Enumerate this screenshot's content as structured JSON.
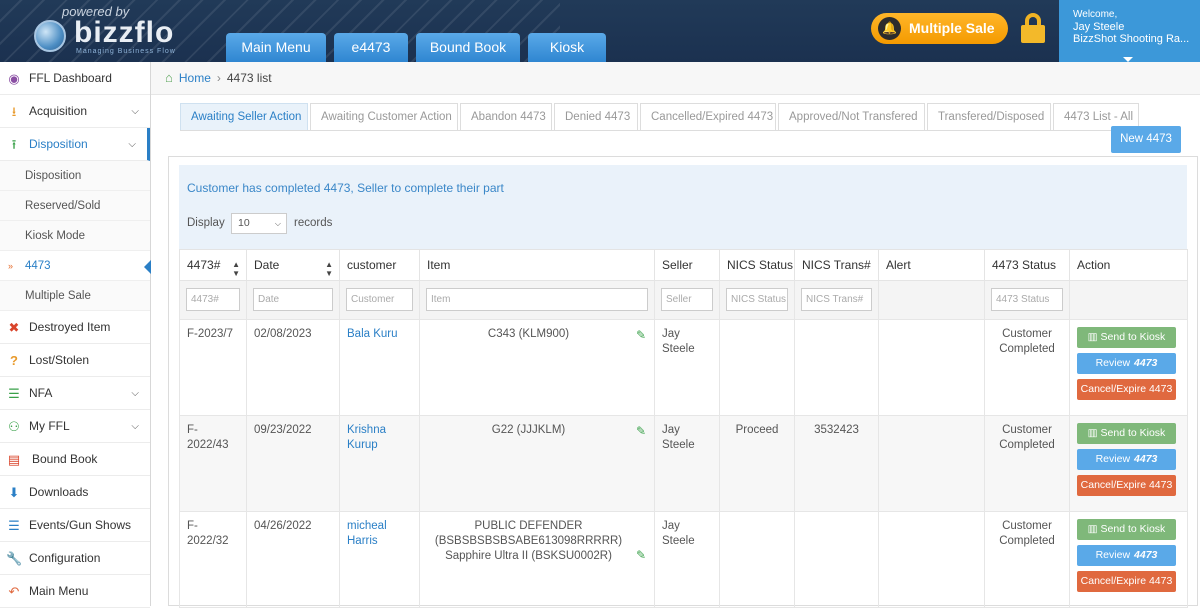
{
  "header": {
    "powered_by": "powered by",
    "brand": "bizzflo",
    "tagline": "Managing Business Flow",
    "nav_tabs": [
      "Main Menu",
      "e4473",
      "Bound Book",
      "Kiosk"
    ],
    "multiple_sale_label": "Multiple Sale",
    "user": {
      "welcome": "Welcome,",
      "name": "Jay Steele",
      "company": "BizzShot Shooting Ra..."
    },
    "colors": {
      "nav_tab": "#3f94da",
      "multiple_sale": "#f5a313",
      "user_box": "#3c98d9"
    }
  },
  "sidebar": {
    "items": [
      {
        "label": "FFL Dashboard",
        "icon": "palette-icon"
      },
      {
        "label": "Acquisition",
        "icon": "download-tray-icon"
      },
      {
        "label": "Disposition",
        "icon": "upload-tray-icon"
      },
      {
        "label": "Destroyed Item",
        "icon": "x-icon"
      },
      {
        "label": "Lost/Stolen",
        "icon": "question-icon"
      },
      {
        "label": "NFA",
        "icon": "list-icon"
      },
      {
        "label": "My FFL",
        "icon": "users-icon"
      },
      {
        "label": "Bound Book",
        "icon": "book-icon"
      },
      {
        "label": "Downloads",
        "icon": "download-circle-icon"
      },
      {
        "label": "Events/Gun Shows",
        "icon": "list-icon"
      },
      {
        "label": "Configuration",
        "icon": "wrench-icon"
      },
      {
        "label": "Main Menu",
        "icon": "back-arrow-icon"
      }
    ],
    "disposition_sub": [
      "Disposition",
      "Reserved/Sold",
      "Kiosk Mode",
      "4473",
      "Multiple Sale"
    ]
  },
  "breadcrumb": {
    "home": "Home",
    "current": "4473 list"
  },
  "tabs": [
    "Awaiting Seller Action",
    "Awaiting Customer Action",
    "Abandon 4473",
    "Denied 4473",
    "Cancelled/Expired 4473",
    "Approved/Not Transfered",
    "Transfered/Disposed",
    "4473 List - All"
  ],
  "new_button": "New 4473",
  "info": {
    "message": "Customer has completed 4473, Seller to complete their part",
    "display_label": "Display",
    "display_value": "10",
    "records_label": "records"
  },
  "table": {
    "headers": [
      "4473#",
      "Date",
      "customer",
      "Item",
      "Seller",
      "NICS Status",
      "NICS Trans#",
      "Alert",
      "4473 Status",
      "Action"
    ],
    "filters": [
      "4473#",
      "Date",
      "Customer",
      "Item",
      "Seller",
      "NICS Status",
      "NICS Trans#",
      "",
      "4473 Status",
      ""
    ],
    "actions": {
      "kiosk": "Send to Kiosk",
      "review": "Review",
      "review_em": "4473",
      "cancel": "Cancel/Expire 4473"
    },
    "rows": [
      {
        "num": "F-2023/7",
        "date": "02/08/2023",
        "customer": "Bala Kuru",
        "item": "C343 (KLM900)",
        "seller": "Jay Steele",
        "nics_status": "",
        "nics_trans": "",
        "alert": "",
        "status": "Customer Completed"
      },
      {
        "num": "F-2022/43",
        "date": "09/23/2022",
        "customer": "Krishna Kurup",
        "item": "G22 (JJJKLM)",
        "seller": "Jay Steele",
        "nics_status": "Proceed",
        "nics_trans": "3532423",
        "alert": "",
        "status": "Customer Completed"
      },
      {
        "num": "F-2022/32",
        "date": "04/26/2022",
        "customer": "micheal Harris",
        "item": "PUBLIC DEFENDER (BSBSBSBSBSABE613098RRRRR) Sapphire Ultra II (BSKSU0002R)",
        "seller": "Jay Steele",
        "nics_status": "",
        "nics_trans": "",
        "alert": "",
        "status": "Customer Completed"
      }
    ]
  }
}
